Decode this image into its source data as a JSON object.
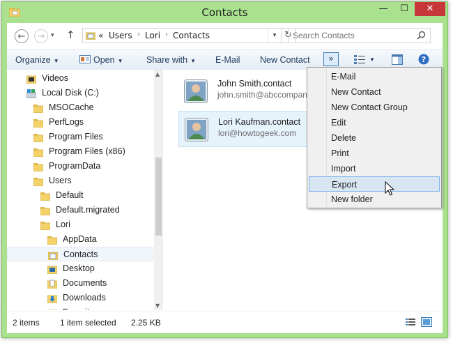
{
  "window": {
    "title": "Contacts",
    "controls": {
      "minimize": "—",
      "maximize": "☐",
      "close": "✕"
    }
  },
  "address": {
    "breadcrumbs": [
      "Users",
      "Lori",
      "Contacts"
    ],
    "overflow": "«",
    "search_placeholder": "Search Contacts"
  },
  "toolbar": {
    "organize": "Organize",
    "open": "Open",
    "share_with": "Share with",
    "email": "E-Mail",
    "new_contact": "New Contact",
    "more": "»"
  },
  "nav": {
    "items": [
      {
        "label": "Videos"
      },
      {
        "label": "Local Disk (C:)"
      },
      {
        "label": "MSOCache"
      },
      {
        "label": "PerfLogs"
      },
      {
        "label": "Program Files"
      },
      {
        "label": "Program Files (x86)"
      },
      {
        "label": "ProgramData"
      },
      {
        "label": "Users"
      },
      {
        "label": "Default"
      },
      {
        "label": "Default.migrated"
      },
      {
        "label": "Lori"
      },
      {
        "label": "AppData"
      },
      {
        "label": "Contacts"
      },
      {
        "label": "Desktop"
      },
      {
        "label": "Documents"
      },
      {
        "label": "Downloads"
      },
      {
        "label": "Favorites"
      }
    ]
  },
  "contacts": [
    {
      "name": "John Smith.contact",
      "email": "john.smith@abccompan"
    },
    {
      "name": "Lori Kaufman.contact",
      "email": "lori@howtogeek.com"
    }
  ],
  "menu": {
    "items": [
      {
        "label": "E-Mail"
      },
      {
        "label": "New Contact"
      },
      {
        "label": "New Contact Group"
      },
      {
        "label": "Edit"
      },
      {
        "label": "Delete"
      },
      {
        "label": "Print"
      },
      {
        "label": "Import"
      },
      {
        "label": "Export"
      },
      {
        "label": "New folder"
      }
    ]
  },
  "status": {
    "items_count": "2 items",
    "selection": "1 item selected",
    "size": "2.25 KB"
  },
  "colors": {
    "frame": "#a9e18f",
    "close_button": "#c7373a",
    "selection": "#e5f3fb",
    "menu_highlight": "#d8e6f2",
    "toolbar_text": "#1e395b"
  }
}
